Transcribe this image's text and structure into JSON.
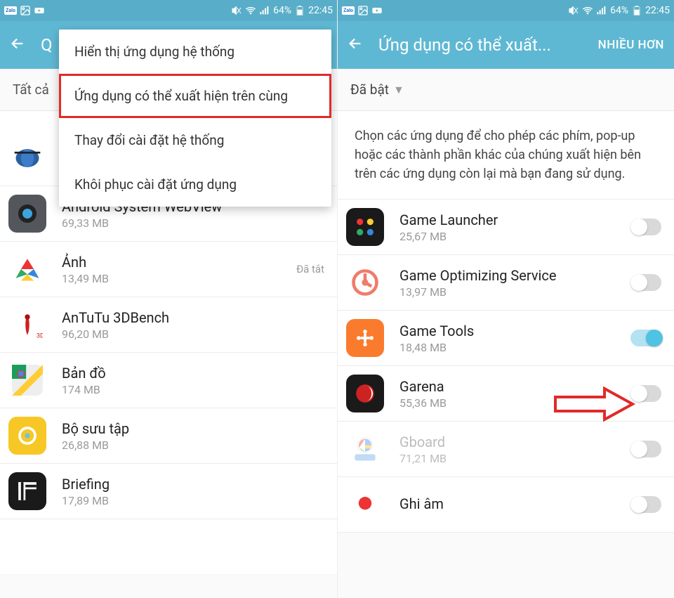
{
  "status": {
    "battery": "64%",
    "time": "22:45",
    "zalo": "Zalo"
  },
  "left": {
    "title_partial": "Q",
    "filter_label": "Tất cả",
    "menu": {
      "item1": "Hiển thị ứng dụng hệ thống",
      "item2": "Ứng dụng có thể xuất hiện trên cùng",
      "item3": "Thay đổi cài đặt hệ thống",
      "item4": "Khôi phục cài đặt ứng dụng"
    },
    "apps": [
      {
        "name": "Android System WebView",
        "size": "69,33 MB",
        "status": ""
      },
      {
        "name": "Ảnh",
        "size": "13,49 MB",
        "status": "Đã tắt"
      },
      {
        "name": "AnTuTu 3DBench",
        "size": "96,20 MB",
        "status": ""
      },
      {
        "name": "Bản đồ",
        "size": "174 MB",
        "status": ""
      },
      {
        "name": "Bộ sưu tập",
        "size": "26,88 MB",
        "status": ""
      },
      {
        "name": "Briefing",
        "size": "17,89 MB",
        "status": ""
      }
    ]
  },
  "right": {
    "title": "Ứng dụng có thể xuất...",
    "more": "NHIỀU HƠN",
    "filter_label": "Đã bật",
    "description": "Chọn các ứng dụng để cho phép các phím, pop-up hoặc các thành phần khác của chúng xuất hiện bên trên các ứng dụng còn lại mà bạn đang sử dụng.",
    "apps": [
      {
        "name": "Game Launcher",
        "size": "25,67 MB",
        "on": false
      },
      {
        "name": "Game Optimizing Service",
        "size": "13,97 MB",
        "on": false
      },
      {
        "name": "Game Tools",
        "size": "18,48 MB",
        "on": true
      },
      {
        "name": "Garena",
        "size": "55,36 MB",
        "on": false
      },
      {
        "name": "Gboard",
        "size": "71,21 MB",
        "on": false,
        "disabled": true
      },
      {
        "name": "Ghi âm",
        "size": "",
        "on": false
      }
    ]
  }
}
